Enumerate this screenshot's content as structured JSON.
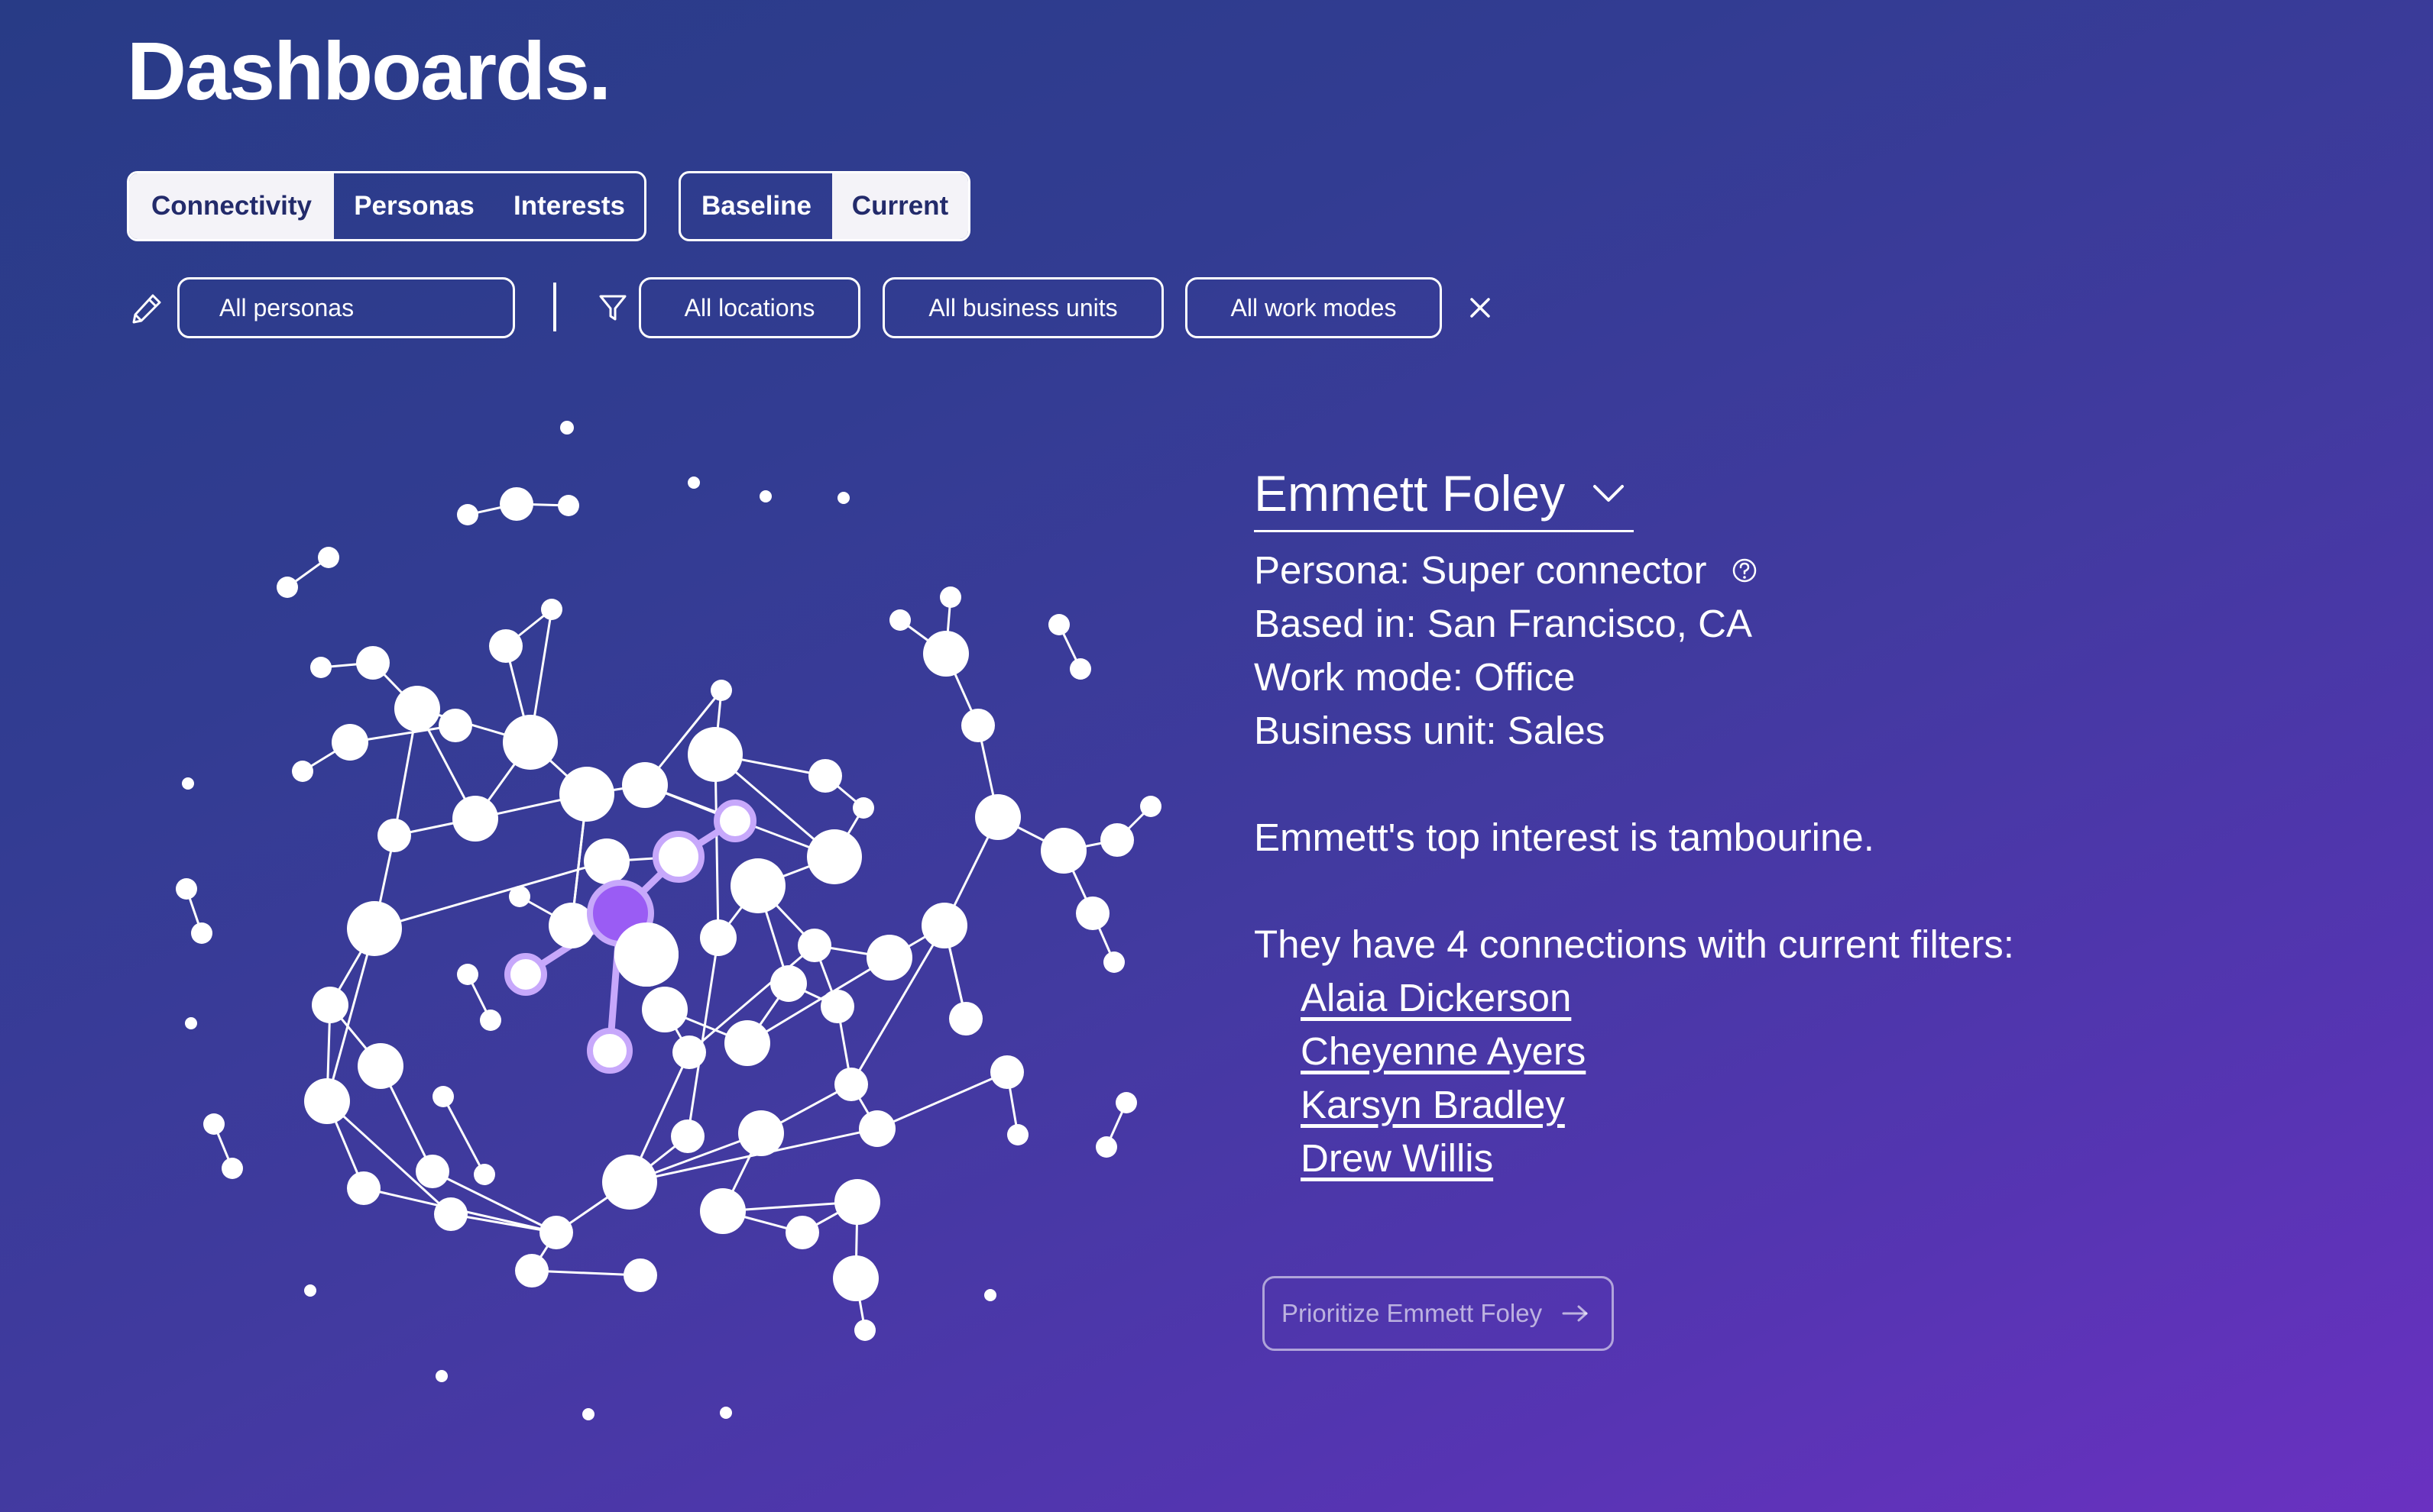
{
  "page_title": "Dashboards.",
  "view_tabs": [
    {
      "label": "Connectivity",
      "active": true
    },
    {
      "label": "Personas",
      "active": false
    },
    {
      "label": "Interests",
      "active": false
    }
  ],
  "period_tabs": [
    {
      "label": "Baseline",
      "active": false
    },
    {
      "label": "Current",
      "active": true
    }
  ],
  "filters": {
    "persona_select": "All personas",
    "locations": "All locations",
    "business_units": "All business units",
    "work_modes": "All work modes"
  },
  "icons": {
    "edit": "pencil-icon",
    "filter": "funnel-icon",
    "clear": "close-icon",
    "dropdown": "chevron-down-icon",
    "help": "question-circle-icon",
    "prioritize": "arrow-right-icon"
  },
  "selected_person": {
    "name": "Emmett Foley",
    "persona": "Persona: Super connector",
    "based_in": "Based in: San Francisco, CA",
    "work_mode": "Work mode: Office",
    "business_unit": "Business unit: Sales",
    "top_interest": "Emmett's top interest is tambourine.",
    "connections_summary": "They have 4 connections with current filters:",
    "connections": [
      "Alaia Dickerson",
      "Cheyenne Ayers",
      "Karsyn Bradley",
      "Drew Willis"
    ],
    "prioritize_label": "Prioritize Emmett Foley"
  },
  "colors": {
    "background_start": "#283b86",
    "background_end": "#6a31c1",
    "node": "#ffffff",
    "selected_node": "#9a5cf4",
    "highlight_ring": "#c7a8fb",
    "active_tab_bg": "#f4f3f8",
    "active_tab_text": "#232b6b"
  }
}
